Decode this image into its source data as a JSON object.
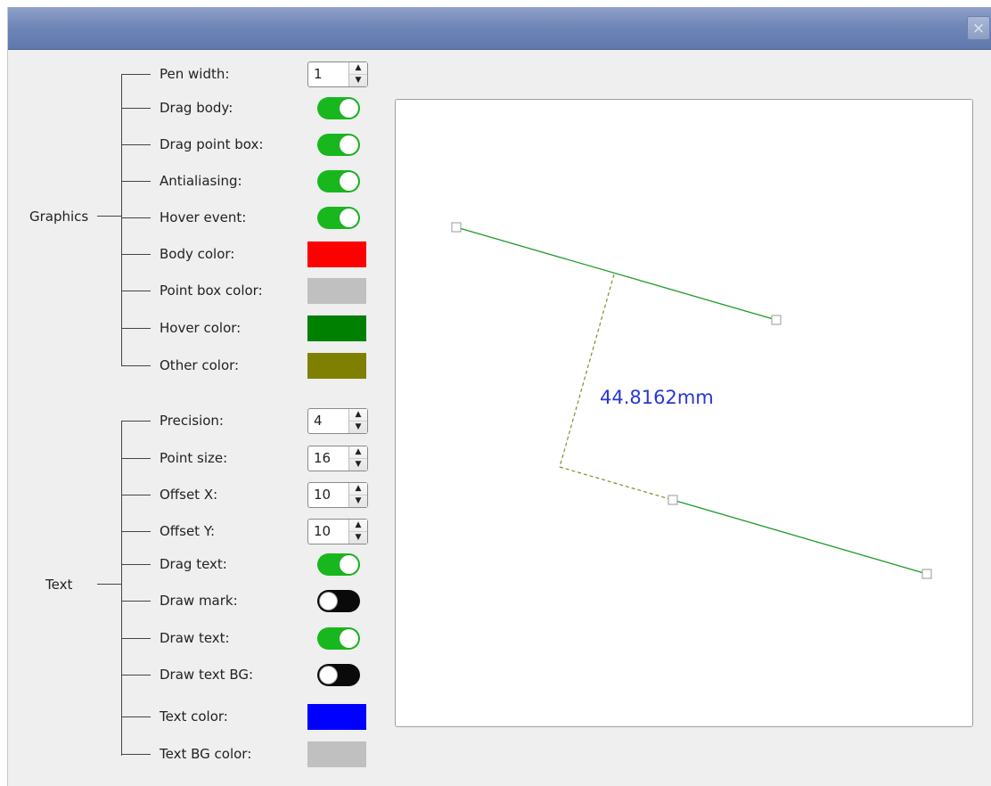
{
  "window": {
    "close_glyph": "×"
  },
  "graphics": {
    "group_label": "Graphics",
    "items": [
      {
        "label": "Pen width:",
        "type": "spin",
        "value": "1"
      },
      {
        "label": "Drag body:",
        "type": "toggle",
        "checked": true
      },
      {
        "label": "Drag point box:",
        "type": "toggle",
        "checked": true
      },
      {
        "label": "Antialiasing:",
        "type": "toggle",
        "checked": true
      },
      {
        "label": "Hover event:",
        "type": "toggle",
        "checked": true
      },
      {
        "label": "Body color:",
        "type": "color",
        "color": "#ff0000"
      },
      {
        "label": "Point box color:",
        "type": "color",
        "color": "#c0c0c0"
      },
      {
        "label": "Hover color:",
        "type": "color",
        "color": "#008000"
      },
      {
        "label": "Other color:",
        "type": "color",
        "color": "#808000"
      }
    ]
  },
  "text": {
    "group_label": "Text",
    "items": [
      {
        "label": "Precision:",
        "type": "spin",
        "value": "4"
      },
      {
        "label": "Point size:",
        "type": "spin",
        "value": "16"
      },
      {
        "label": "Offset X:",
        "type": "spin",
        "value": "10"
      },
      {
        "label": "Offset Y:",
        "type": "spin",
        "value": "10"
      },
      {
        "label": "Drag text:",
        "type": "toggle",
        "checked": true
      },
      {
        "label": "Draw mark:",
        "type": "toggle",
        "checked": false
      },
      {
        "label": "Draw text:",
        "type": "toggle",
        "checked": true
      },
      {
        "label": "Draw text BG:",
        "type": "toggle",
        "checked": false
      },
      {
        "label": "Text color:",
        "type": "color",
        "color": "#0000ff"
      },
      {
        "label": "Text BG color:",
        "type": "color",
        "color": "#c0c0c0"
      }
    ]
  },
  "canvas": {
    "measurement_label": "44.8162mm",
    "line_color": "#1f9a2a",
    "guide_color": "#8a8a30",
    "measurement_color": "#2a36d4",
    "point_box_color": "#9a9a9a"
  }
}
